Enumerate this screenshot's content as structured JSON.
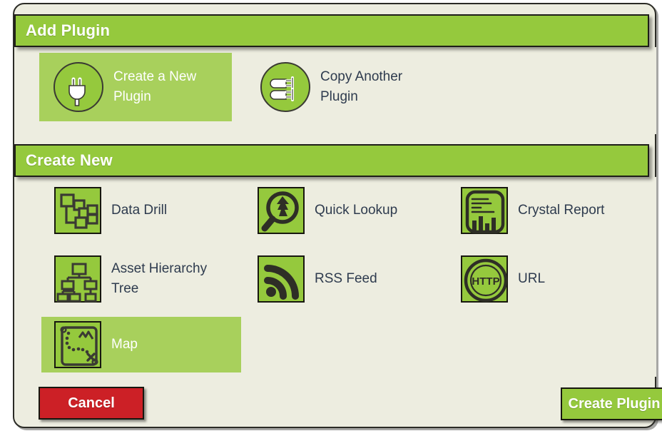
{
  "dialog": {
    "sections": [
      {
        "id": "add-plugin",
        "title": "Add Plugin"
      },
      {
        "id": "create-new",
        "title": "Create New"
      }
    ]
  },
  "add_plugin": {
    "options": [
      {
        "id": "create-new-plugin",
        "label": "Create a New\nPlugin",
        "icon": "plug-icon",
        "selected": true
      },
      {
        "id": "copy-another-plugin",
        "label": "Copy Another\nPlugin",
        "icon": "two-plugs-icon",
        "selected": false
      }
    ]
  },
  "create_new": {
    "options": [
      {
        "id": "data-drill",
        "label": "Data Drill",
        "icon": "data-drill-icon",
        "selected": false
      },
      {
        "id": "quick-lookup",
        "label": "Quick Lookup",
        "icon": "magnifier-bolt-icon",
        "selected": false
      },
      {
        "id": "crystal-report",
        "label": "Crystal Report",
        "icon": "report-chart-icon",
        "selected": false
      },
      {
        "id": "asset-hierarchy-tree",
        "label": "Asset Hierarchy\nTree",
        "icon": "hierarchy-tree-icon",
        "selected": false
      },
      {
        "id": "rss-feed",
        "label": "RSS Feed",
        "icon": "rss-icon",
        "selected": false
      },
      {
        "id": "url",
        "label": "URL",
        "icon": "http-globe-icon",
        "selected": false
      },
      {
        "id": "map",
        "label": "Map",
        "icon": "treasure-map-icon",
        "selected": true
      }
    ]
  },
  "footer": {
    "cancel_label": "Cancel",
    "create_label": "Create Plugin"
  },
  "colors": {
    "green": "#95c93d",
    "green_light": "#a8d05c",
    "beige": "#edede0",
    "red": "#cc2026",
    "ink": "#2e3b4e",
    "outline": "#17170f"
  }
}
